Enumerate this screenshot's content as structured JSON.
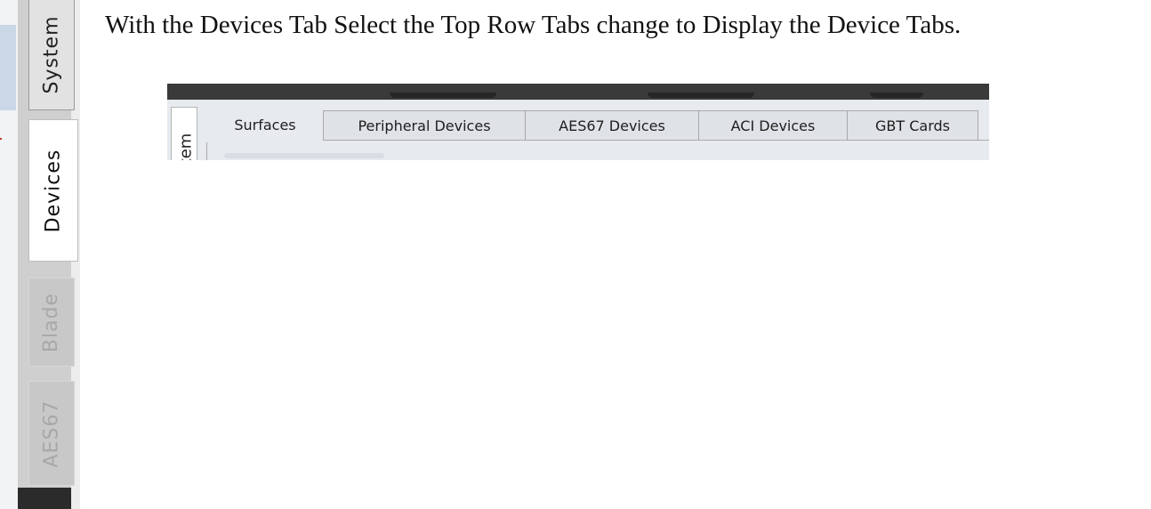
{
  "instruction": "With the Devices Tab Select the Top Row Tabs change to Display the Device Tabs.",
  "sidebar": {
    "tabs": [
      {
        "label": "System",
        "state": "inactive"
      },
      {
        "label": "Devices",
        "state": "selected"
      },
      {
        "label": "Blade",
        "state": "disabled"
      },
      {
        "label": "AES67",
        "state": "disabled"
      }
    ]
  },
  "screenshot": {
    "side_tab_partial": "tem",
    "top_tabs": [
      {
        "label": "Surfaces",
        "active": true
      },
      {
        "label": "Peripheral Devices",
        "active": false
      },
      {
        "label": "AES67 Devices",
        "active": false
      },
      {
        "label": "ACI Devices",
        "active": false
      },
      {
        "label": "GBT Cards",
        "active": false
      }
    ]
  },
  "colors": {
    "selected_tab_bg": "#ffffff",
    "inactive_tab_bg": "#e2e2e2",
    "disabled_tab_bg": "#c8c8c8",
    "disabled_text": "#a8a8a8",
    "top_bar": "#3a3a3a",
    "tab_panel_bg": "#e7eaef"
  }
}
